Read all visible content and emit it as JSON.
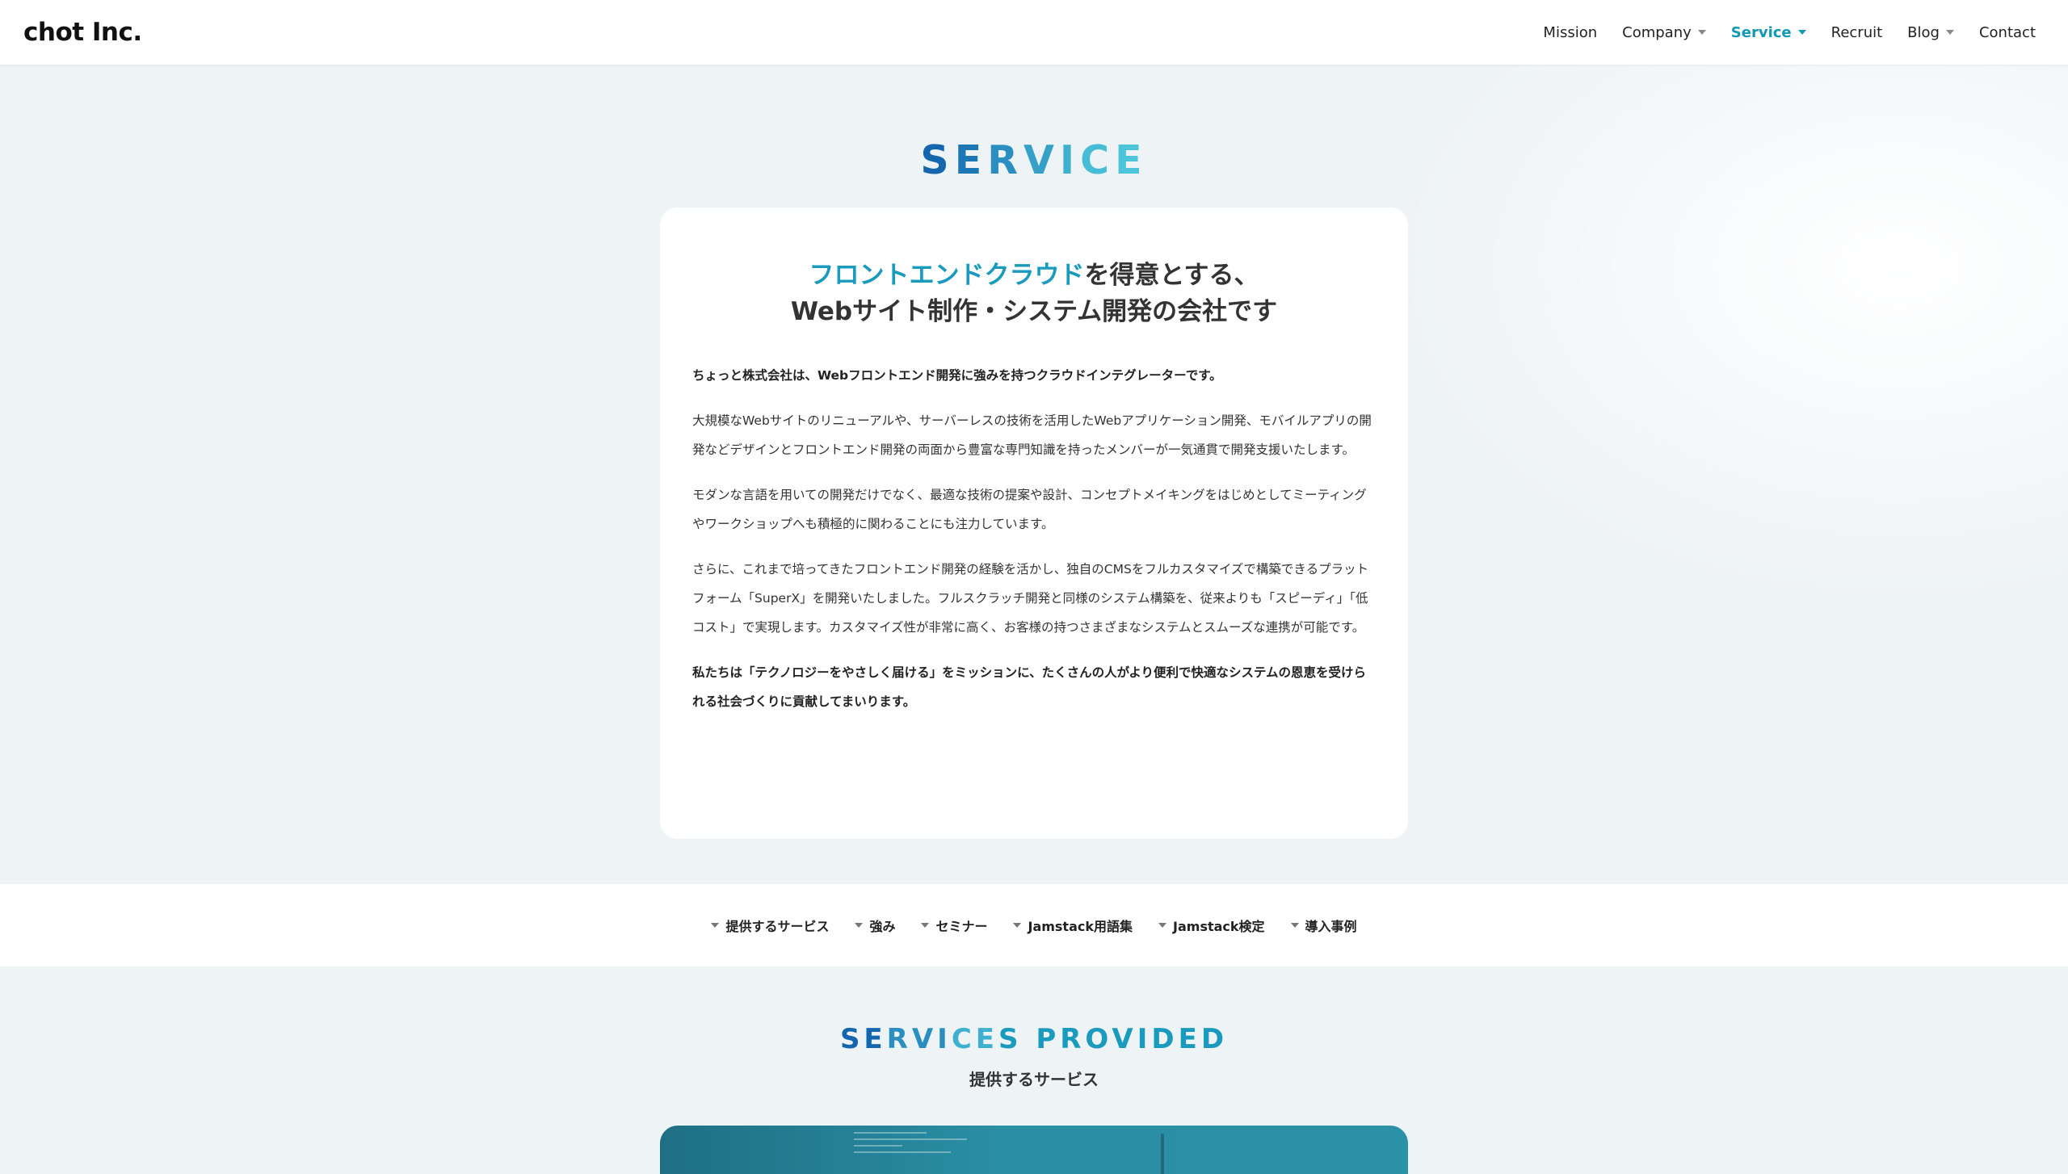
{
  "header": {
    "logo": "chot Inc.",
    "nav": [
      {
        "label": "Mission",
        "dropdown": false,
        "active": false
      },
      {
        "label": "Company",
        "dropdown": true,
        "active": false
      },
      {
        "label": "Service",
        "dropdown": true,
        "active": true
      },
      {
        "label": "Recruit",
        "dropdown": false,
        "active": false
      },
      {
        "label": "Blog",
        "dropdown": true,
        "active": false
      },
      {
        "label": "Contact",
        "dropdown": false,
        "active": false
      }
    ]
  },
  "hero": {
    "title_letters": [
      "S",
      "E",
      "R",
      "V",
      "I",
      "C",
      "E"
    ]
  },
  "card": {
    "heading_accent": "フロントエンドクラウド",
    "heading_rest": "を得意とする、",
    "heading_line2": "Webサイト制作・システム開発の会社です",
    "paragraphs": [
      "ちょっと株式会社は、Webフロントエンド開発に強みを持つクラウドインテグレーターです。",
      "大規模なWebサイトのリニューアルや、サーバーレスの技術を活用したWebアプリケーション開発、モバイルアプリの開発などデザインとフロントエンド開発の両面から豊富な専門知識を持ったメンバーが一気通貫で開発支援いたします。",
      "モダンな言語を用いての開発だけでなく、最適な技術の提案や設計、コンセプトメイキングをはじめとしてミーティングやワークショップへも積極的に関わることにも注力しています。",
      "さらに、これまで培ってきたフロントエンド開発の経験を活かし、独自のCMSをフルカスタマイズで構築できるプラットフォーム「SuperX」を開発いたしました。フルスクラッチ開発と同様のシステム構築を、従来よりも「スピーディ」「低コスト」で実現します。カスタマイズ性が非常に高く、お客様の持つさまざまなシステムとスムーズな連携が可能です。",
      "私たちは「テクノロジーをやさしく届ける」をミッションに、たくさんの人がより便利で快適なシステムの恩恵を受けられる社会づくりに貢献してまいります。"
    ]
  },
  "subnav": [
    "提供するサービス",
    "強み",
    "セミナー",
    "Jamstack用語集",
    "Jamstack検定",
    "導入事例"
  ],
  "services": {
    "title_parts": [
      "SE",
      "RVI",
      "CE",
      "S PROVIDED"
    ],
    "subtitle": "提供するサービス"
  }
}
